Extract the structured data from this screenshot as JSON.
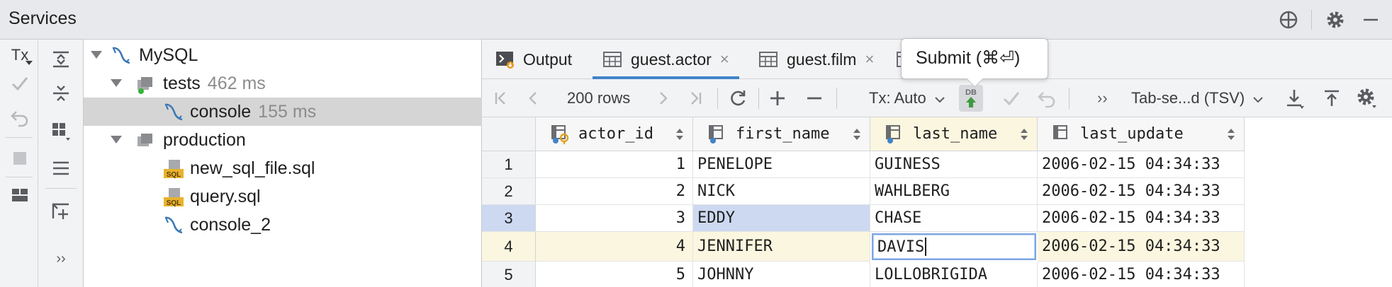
{
  "window": {
    "title": "Services"
  },
  "tree": {
    "items": [
      {
        "label": "MySQL",
        "time": "",
        "icon": "mysql-dolphin-icon"
      },
      {
        "label": "tests",
        "time": "462 ms",
        "icon": "session-icon"
      },
      {
        "label": "console",
        "time": "155 ms",
        "icon": "mysql-dolphin-icon"
      },
      {
        "label": "production",
        "time": "",
        "icon": "session-icon"
      },
      {
        "label": "new_sql_file.sql",
        "time": "",
        "icon": "sql-file-icon"
      },
      {
        "label": "query.sql",
        "time": "",
        "icon": "sql-file-icon"
      },
      {
        "label": "console_2",
        "time": "",
        "icon": "mysql-dolphin-icon"
      }
    ],
    "sql_badge": "SQL"
  },
  "left_strip": {
    "tx_label": "Tx",
    "more_label": "››"
  },
  "tabs": [
    {
      "label": "Output",
      "closable": false
    },
    {
      "label": "guest.actor",
      "closable": true
    },
    {
      "label": "guest.film",
      "closable": true
    }
  ],
  "tab_close_glyph": "×",
  "toolbar": {
    "rows_label": "200 rows",
    "tx_mode": "Tx: Auto",
    "db_badge": "DB",
    "more": "››",
    "format": "Tab-se...d (TSV)"
  },
  "tooltip": {
    "text": "Submit (⌘⏎)"
  },
  "grid": {
    "columns": [
      "actor_id",
      "first_name",
      "last_name",
      "last_update"
    ],
    "rows": [
      {
        "num": "1",
        "actor_id": "1",
        "first_name": "PENELOPE",
        "last_name": "GUINESS",
        "last_update": "2006-02-15 04:34:33"
      },
      {
        "num": "2",
        "actor_id": "2",
        "first_name": "NICK",
        "last_name": "WAHLBERG",
        "last_update": "2006-02-15 04:34:33"
      },
      {
        "num": "3",
        "actor_id": "3",
        "first_name": "EDDY",
        "last_name": "CHASE",
        "last_update": "2006-02-15 04:34:33"
      },
      {
        "num": "4",
        "actor_id": "4",
        "first_name": "JENNIFER",
        "last_name": "DAVIS",
        "last_update": "2006-02-15 04:34:33"
      },
      {
        "num": "5",
        "actor_id": "5",
        "first_name": "JOHNNY",
        "last_name": "LOLLOBRIGIDA",
        "last_update": "2006-02-15 04:34:33"
      }
    ]
  },
  "colors": {
    "accent": "#4083c9",
    "selection": "#ccd9f0",
    "edited_row": "#fbf6df",
    "submit_green": "#3d9a3d",
    "mysql_blue": "#3a78b5"
  }
}
